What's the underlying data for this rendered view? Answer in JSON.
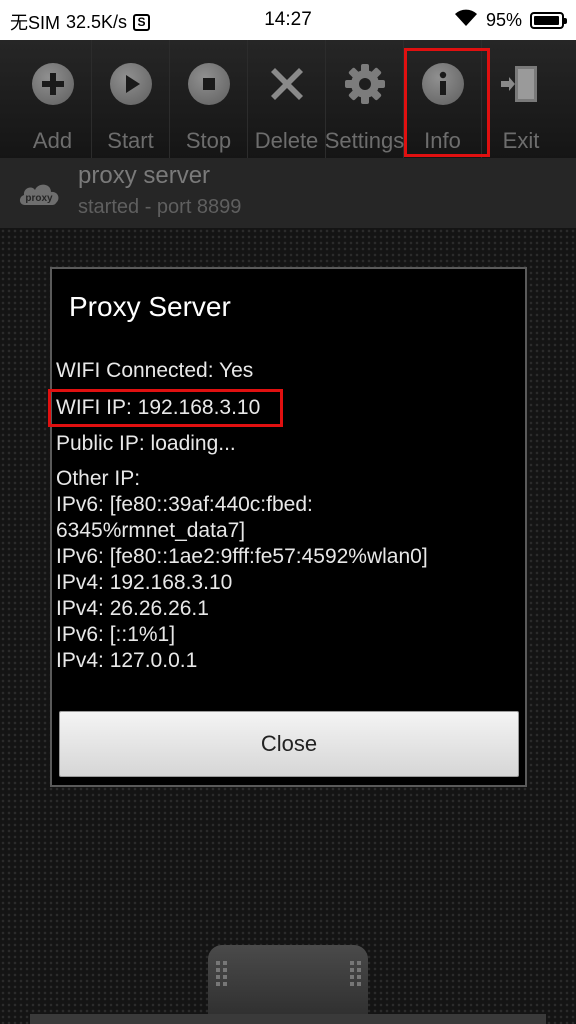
{
  "status_bar": {
    "carrier": "无SIM",
    "speed": "32.5K/s",
    "s_badge": "S",
    "time": "14:27",
    "battery": "95%",
    "battery_level": 0.95
  },
  "toolbar": {
    "buttons": [
      {
        "label": "Add",
        "icon": "add-icon"
      },
      {
        "label": "Start",
        "icon": "play-icon"
      },
      {
        "label": "Stop",
        "icon": "stop-icon"
      },
      {
        "label": "Delete",
        "icon": "delete-icon"
      },
      {
        "label": "Settings",
        "icon": "gear-icon"
      },
      {
        "label": "Info",
        "icon": "info-icon"
      },
      {
        "label": "Exit",
        "icon": "exit-icon"
      }
    ],
    "highlighted": "Info"
  },
  "service": {
    "logo_text": "proxy",
    "name": "proxy server",
    "status": "started - port 8899"
  },
  "dialog": {
    "title": "Proxy Server",
    "wifi_connected": "WIFI Connected: Yes",
    "wifi_ip": "WIFI IP: 192.168.3.10",
    "public_ip": "Public IP: loading...",
    "other_ip_label": "Other IP:",
    "other_ips": [
      "IPv6: [fe80::39af:440c:fbed:",
      "6345%rmnet_data7]",
      "IPv6: [fe80::1ae2:9fff:fe57:4592%wlan0]",
      "IPv4: 192.168.3.10",
      "IPv4: 26.26.26.1",
      "IPv6: [::1%1]",
      "IPv4: 127.0.0.1"
    ],
    "close_label": "Close"
  },
  "colors": {
    "highlight": "#e01010",
    "toolbar_label": "#6d6d6d",
    "dialog_bg": "#000000"
  }
}
